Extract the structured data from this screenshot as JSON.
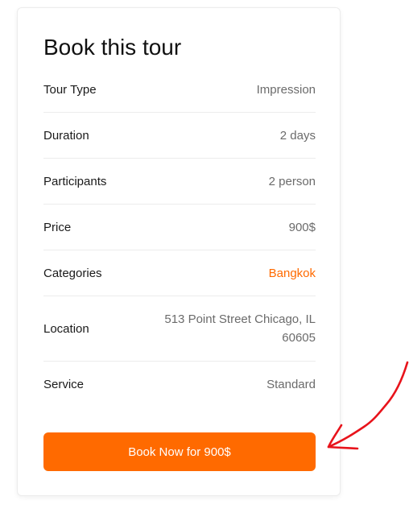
{
  "card": {
    "title": "Book this tour",
    "rows": [
      {
        "label": "Tour Type",
        "value": "Impression"
      },
      {
        "label": "Duration",
        "value": "2 days"
      },
      {
        "label": "Participants",
        "value": "2 person"
      },
      {
        "label": "Price",
        "value": "900$"
      },
      {
        "label": "Categories",
        "value": "Bangkok"
      },
      {
        "label": "Location",
        "value": "513 Point Street Chicago, IL 60605"
      },
      {
        "label": "Service",
        "value": "Standard"
      }
    ],
    "button_label": "Book Now for 900$"
  },
  "colors": {
    "accent": "#ff6a00",
    "annotation": "#e8131b"
  },
  "annotation": {
    "icon": "hand-drawn-arrow-icon"
  }
}
